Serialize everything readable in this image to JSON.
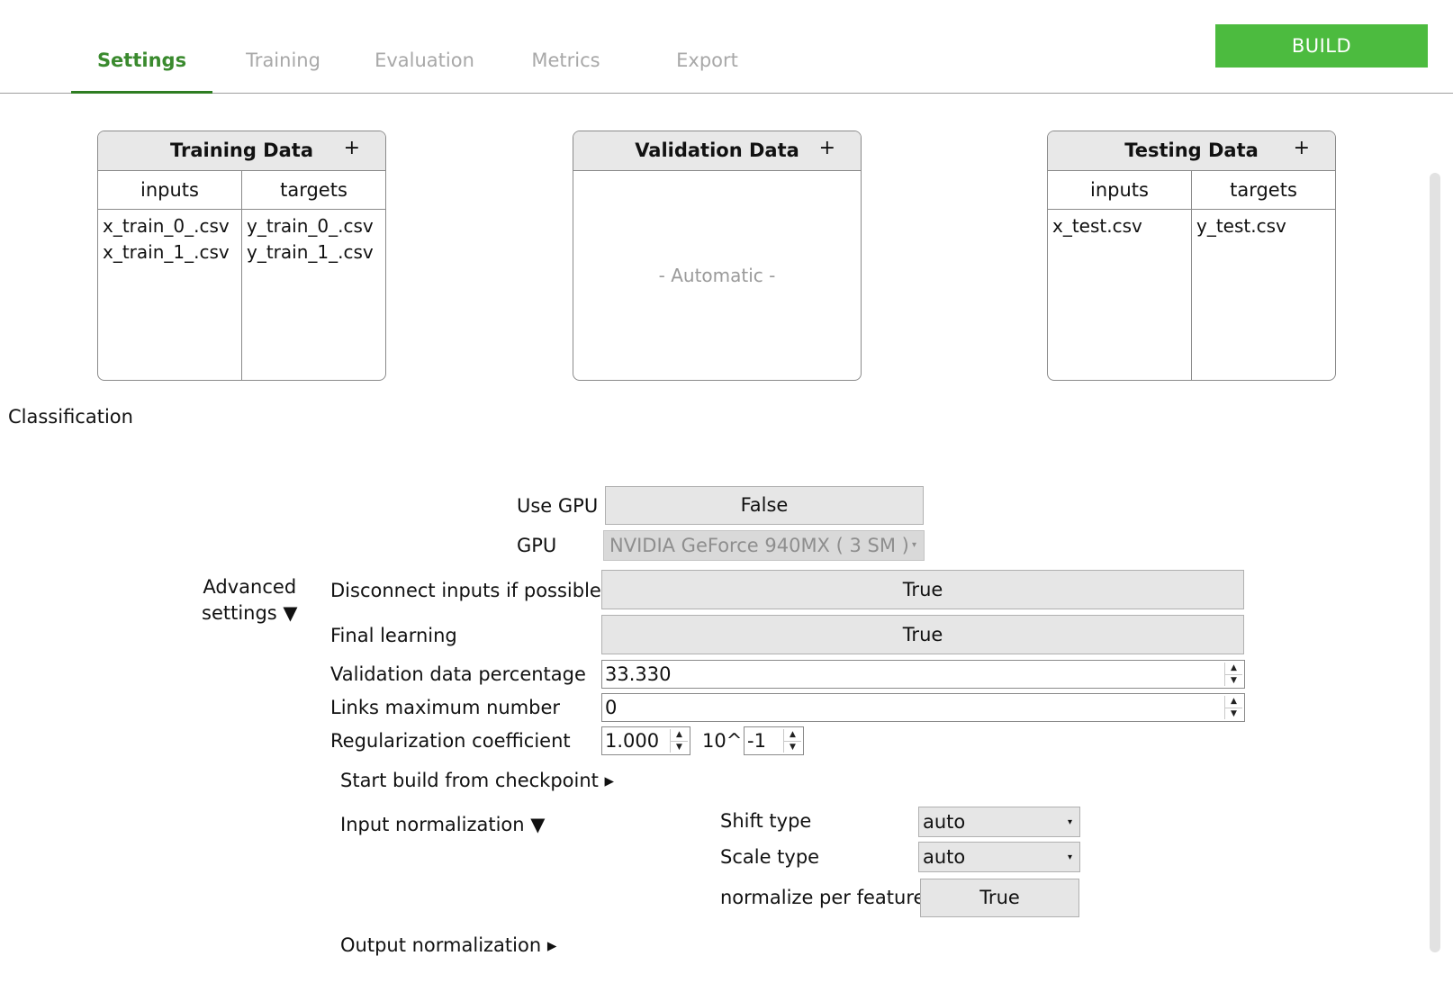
{
  "tabs": [
    {
      "label": "Settings",
      "active": true
    },
    {
      "label": "Training",
      "active": false
    },
    {
      "label": "Evaluation",
      "active": false
    },
    {
      "label": "Metrics",
      "active": false
    },
    {
      "label": "Export",
      "active": false
    }
  ],
  "build_button": "BUILD",
  "panels": {
    "training": {
      "title": "Training Data",
      "add": "+",
      "inputs_header": "inputs",
      "targets_header": "targets",
      "inputs": [
        "x_train_0_.csv",
        "x_train_1_.csv"
      ],
      "targets": [
        "y_train_0_.csv",
        "y_train_1_.csv"
      ]
    },
    "validation": {
      "title": "Validation Data",
      "add": "+",
      "placeholder": "- Automatic -"
    },
    "testing": {
      "title": "Testing Data",
      "add": "+",
      "inputs_header": "inputs",
      "targets_header": "targets",
      "inputs": [
        "x_test.csv"
      ],
      "targets": [
        "y_test.csv"
      ]
    }
  },
  "section_title": "Classification",
  "settings": {
    "use_gpu": {
      "label": "Use GPU",
      "value": "False"
    },
    "gpu": {
      "label": "GPU",
      "value": "NVIDIA GeForce 940MX ( 3 SM )"
    },
    "advanced": {
      "line1": "Advanced",
      "line2": "settings ▼"
    },
    "disconnect_inputs": {
      "label": "Disconnect inputs if possible",
      "value": "True"
    },
    "final_learning": {
      "label": "Final learning",
      "value": "True"
    },
    "validation_pct": {
      "label": "Validation data percentage",
      "value": "33.330"
    },
    "links_max": {
      "label": "Links maximum number",
      "value": "0"
    },
    "regularization": {
      "label": "Regularization coefficient",
      "mantissa": "1.000",
      "base": "10^",
      "exponent": "-1"
    },
    "start_checkpoint": "Start build from checkpoint ▸",
    "input_norm": "Input normalization ▼",
    "shift_type": {
      "label": "Shift type",
      "value": "auto"
    },
    "scale_type": {
      "label": "Scale type",
      "value": "auto"
    },
    "normalize_per_feature": {
      "label": "normalize per feature",
      "value": "True"
    },
    "output_norm": "Output normalization ▸"
  },
  "icons": {
    "spin_up": "▲",
    "spin_down": "▼",
    "dropdown": "▾"
  },
  "colors": {
    "accent_green": "#4cbb3f",
    "active_tab": "#3a8a2e"
  }
}
